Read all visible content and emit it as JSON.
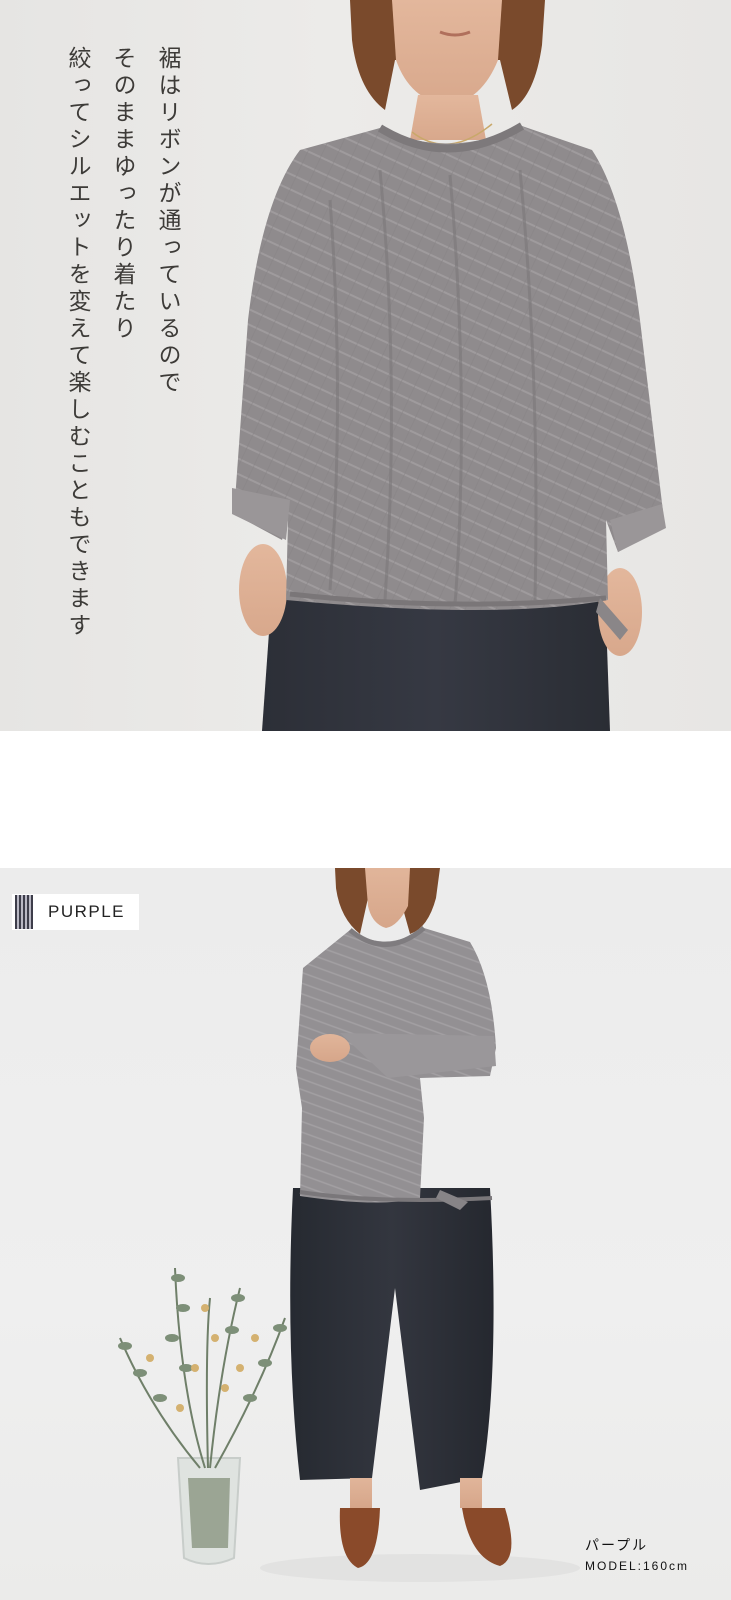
{
  "hero_text": {
    "line1": "裾はリボンが通っているので",
    "line2": "そのままゆったり着たり",
    "line3": "絞ってシルエットを変えて楽しむこともできます"
  },
  "color_tag": {
    "label": "PURPLE"
  },
  "caption": {
    "color_name": "パープル",
    "model_info": "MODEL:160cm"
  }
}
